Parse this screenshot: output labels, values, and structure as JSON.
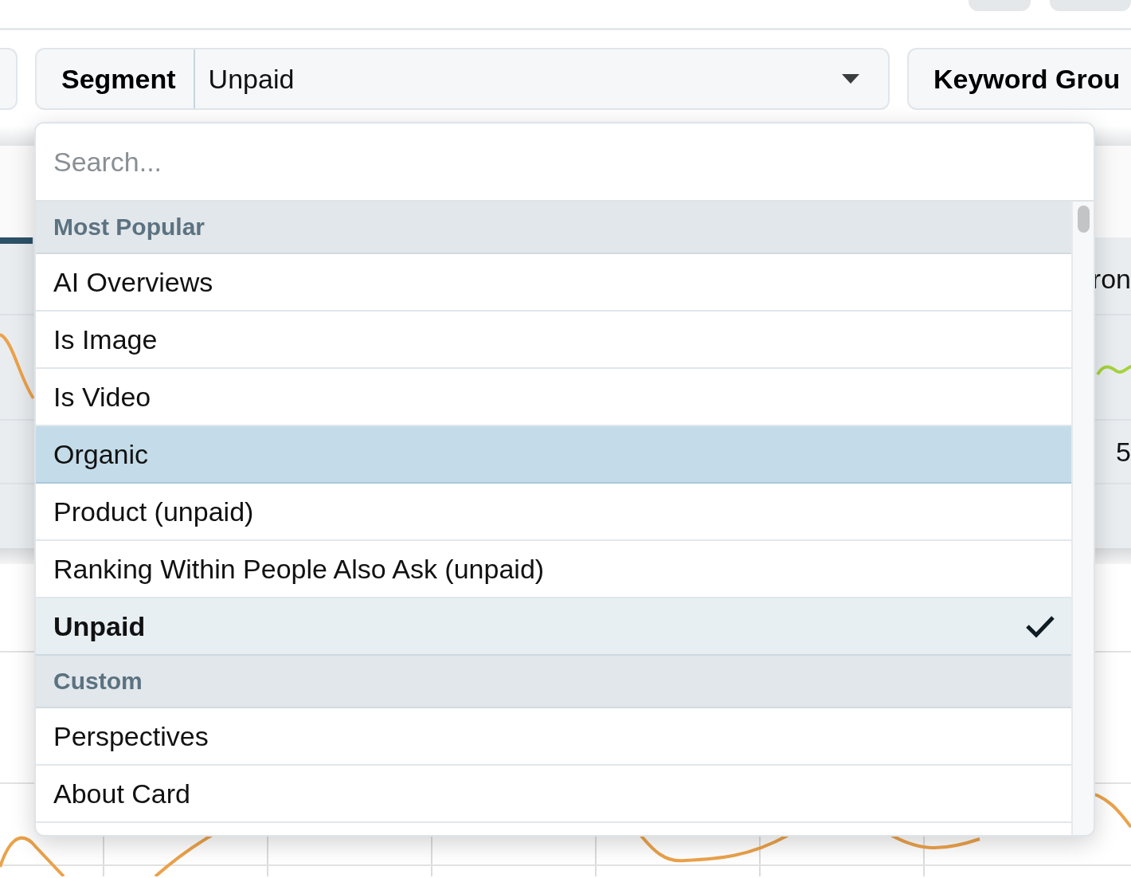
{
  "top_buttons": [
    {
      "kind": "pill"
    },
    {
      "kind": "pill"
    }
  ],
  "filters": [
    {
      "label": "Segment",
      "value": "Unpaid"
    },
    {
      "label": "Keyword Grou"
    }
  ],
  "dropdown": {
    "search": {
      "placeholder": "Search..."
    },
    "groups": [
      {
        "title": "Most Popular",
        "options": [
          {
            "label": "AI Overviews",
            "highlighted": false,
            "selected": false
          },
          {
            "label": "Is Image",
            "highlighted": false,
            "selected": false
          },
          {
            "label": "Is Video",
            "highlighted": false,
            "selected": false
          },
          {
            "label": "Organic",
            "highlighted": true,
            "selected": false
          },
          {
            "label": "Product (unpaid)",
            "highlighted": false,
            "selected": false
          },
          {
            "label": "Ranking Within People Also Ask (unpaid)",
            "highlighted": false,
            "selected": false
          },
          {
            "label": "Unpaid",
            "highlighted": false,
            "selected": true
          }
        ]
      },
      {
        "title": "Custom",
        "options": [
          {
            "label": "Perspectives",
            "highlighted": false,
            "selected": false
          },
          {
            "label": "About Card",
            "highlighted": false,
            "selected": false
          }
        ]
      }
    ]
  },
  "background_cells": [
    "ron",
    "5"
  ]
}
